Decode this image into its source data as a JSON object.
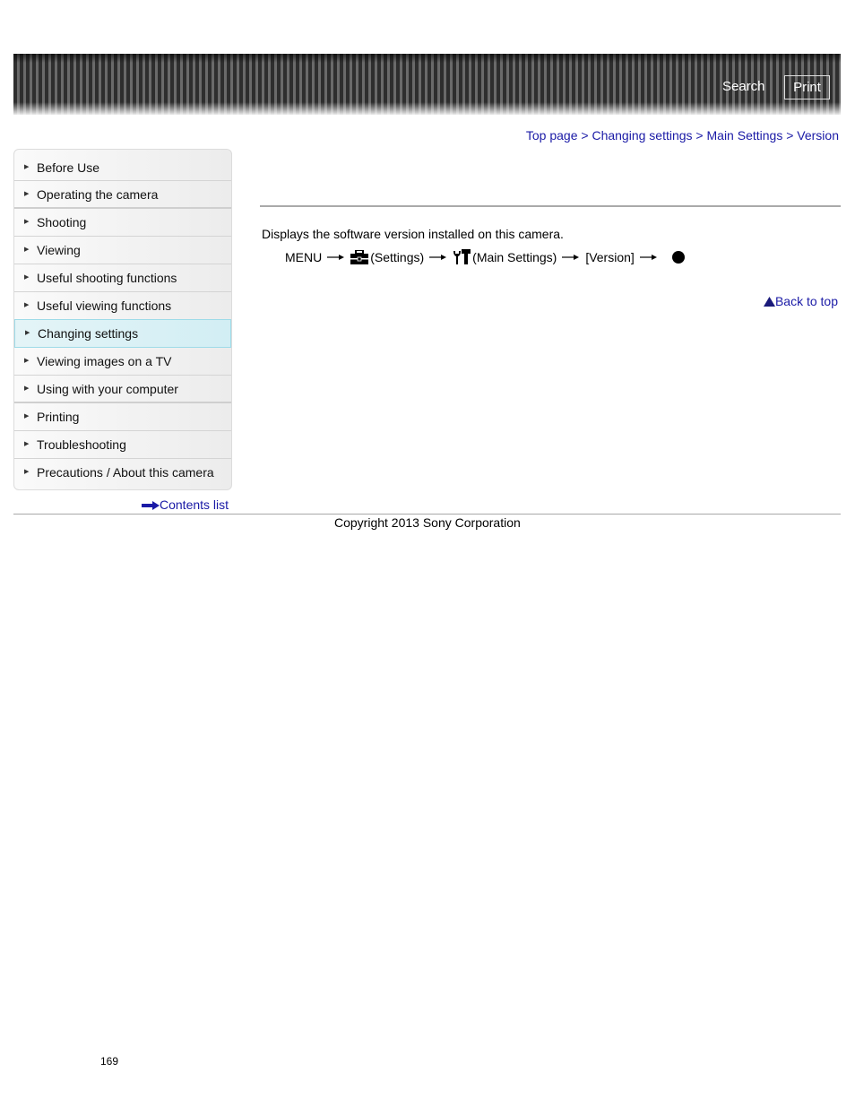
{
  "header": {
    "search_label": "Search",
    "print_label": "Print"
  },
  "breadcrumb": {
    "items": [
      "Top page",
      "Changing settings",
      "Main Settings",
      "Version"
    ],
    "separator": " > "
  },
  "sidebar": {
    "items": [
      {
        "label": "Before Use"
      },
      {
        "label": "Operating the camera"
      },
      {
        "label": "Shooting"
      },
      {
        "label": "Viewing"
      },
      {
        "label": "Useful shooting functions"
      },
      {
        "label": "Useful viewing functions"
      },
      {
        "label": "Changing settings",
        "active": true
      },
      {
        "label": "Viewing images on a TV"
      },
      {
        "label": "Using with your computer"
      },
      {
        "label": "Printing"
      },
      {
        "label": "Troubleshooting"
      },
      {
        "label": "Precautions / About this camera"
      }
    ],
    "contents_link": "Contents list"
  },
  "main": {
    "description": "Displays the software version installed on this camera.",
    "menu_path": {
      "menu": "MENU",
      "settings": "(Settings)",
      "main_settings": "(Main Settings)",
      "version": "[Version]"
    },
    "back_to_top": "Back to top"
  },
  "footer": {
    "copyright": "Copyright 2013 Sony Corporation",
    "page_number": "169"
  },
  "colors": {
    "link": "#1a1aa6",
    "active_item_bg": "#d8f0f5",
    "active_item_border": "#9edbe8"
  }
}
